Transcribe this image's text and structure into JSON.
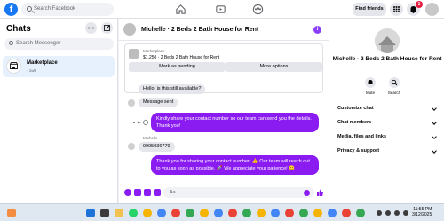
{
  "topbar": {
    "logo": "f",
    "search_placeholder": "Search Facebook",
    "find_friends": "Find friends",
    "notification_count": "1"
  },
  "sidebar": {
    "title": "Chats",
    "search_placeholder": "Search Messenger",
    "items": [
      {
        "name": "Marketplace",
        "sub": "· 1wk"
      }
    ]
  },
  "chat": {
    "title": "Michelle · 2 Beds 2 Bath House for Rent",
    "info_icon": "i",
    "listing": {
      "label": "Marketplace",
      "detail": "$1,250 · 2 Beds 2 Bath House for Rent",
      "mark_pending": "Mark as pending",
      "more_options": "More options"
    },
    "messages": [
      {
        "from": "them",
        "text": "Hello, is this still available?"
      },
      {
        "from": "them",
        "text": "Message sent"
      },
      {
        "from": "me",
        "text": "Kindly share your contact number so our team can send you the details. Thank you!"
      },
      {
        "from": "them",
        "sender": "Michelle",
        "text": "9095036779"
      },
      {
        "from": "me",
        "text": "Thank you for sharing your contact number! 👍 Our team will reach out to you as soon as possible. 🚀 We appreciate your patience! 😊"
      }
    ],
    "composer_placeholder": "Aa"
  },
  "details": {
    "name": "Michelle · 2 Beds 2 Bath House for Rent",
    "actions": [
      "Mute",
      "Search"
    ],
    "sections": [
      "Customize chat",
      "Chat members",
      "Media, files and links",
      "Privacy & support"
    ]
  },
  "taskbar": {
    "time": "11:55 PM",
    "date": "3/12/2025"
  },
  "colors": {
    "brand": "#1877f2",
    "accent": "#8a1cf2"
  }
}
